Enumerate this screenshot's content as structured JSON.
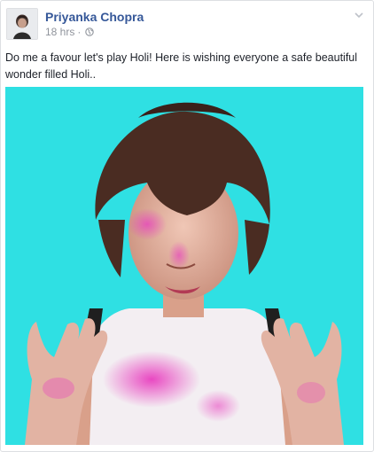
{
  "post": {
    "author": "Priyanka Chopra",
    "timestamp": "18 hrs",
    "separator": "·",
    "privacy_icon": "globe-icon",
    "options_icon": "chevron-down-icon",
    "text": "Do me a favour let's play Holi! Here is wishing everyone a safe beautiful wonder filled Holi..",
    "photo_subject": "woman with colored powder on face and white top against turquoise background"
  },
  "colors": {
    "author_link": "#365899",
    "meta_text": "#90949c",
    "body_text": "#1d2129",
    "photo_background": "#2fe0e3",
    "holi_pink": "#e83fbf"
  }
}
